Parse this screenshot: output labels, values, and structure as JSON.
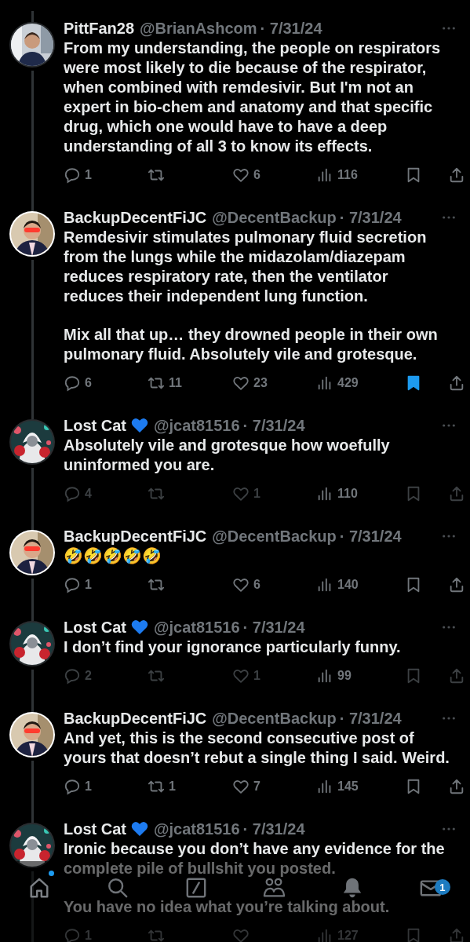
{
  "tweets": [
    {
      "name": "PittFan28",
      "heart_badge": false,
      "handle": "@BrianAshcom",
      "date": "· 7/31/24",
      "body": [
        "From my understanding, the people on respirators were most likely to die because of the respirator, when combined with remdesivir. But I'm not an expert in bio-chem and anatomy and that specific drug, which one would have to have a deep understanding of all 3 to know its effects."
      ],
      "replies": "1",
      "likes": "6",
      "views": "116",
      "bookmarked": false,
      "faded": false
    },
    {
      "name": "BackupDecentFiJC",
      "heart_badge": false,
      "handle": "@DecentBackup",
      "date": "· 7/31/24",
      "body": [
        "Remdesivir stimulates pulmonary fluid secretion from the lungs while the midazolam/diazepam reduces respiratory rate, then the ventilator reduces their independent lung function.",
        "Mix all that up… they drowned people in their own pulmonary fluid. Absolutely vile and grotesque."
      ],
      "replies": "6",
      "reposts": "11",
      "likes": "23",
      "views": "429",
      "bookmarked": true,
      "faded": false
    },
    {
      "name": "Lost Cat",
      "heart_badge": true,
      "handle": "@jcat81516",
      "date": "· 7/31/24",
      "body": [
        "Absolutely vile and grotesque how woefully uninformed you are."
      ],
      "replies": "4",
      "likes": "1",
      "views": "110",
      "bookmarked": false,
      "faded": true
    },
    {
      "name": "BackupDecentFiJC",
      "heart_badge": false,
      "handle": "@DecentBackup",
      "date": "· 7/31/24",
      "body": [
        "🤣🤣🤣🤣🤣"
      ],
      "replies": "1",
      "likes": "6",
      "views": "140",
      "bookmarked": false,
      "faded": false
    },
    {
      "name": "Lost Cat",
      "heart_badge": true,
      "handle": "@jcat81516",
      "date": "· 7/31/24",
      "body": [
        "I don’t find your ignorance particularly funny."
      ],
      "replies": "2",
      "likes": "1",
      "views": "99",
      "bookmarked": false,
      "faded": true
    },
    {
      "name": "BackupDecentFiJC",
      "heart_badge": false,
      "handle": "@DecentBackup",
      "date": "· 7/31/24",
      "body": [
        "And yet, this is the second consecutive post of yours that doesn’t rebut a single thing I said. Weird."
      ],
      "replies": "1",
      "reposts": "1",
      "likes": "7",
      "views": "145",
      "bookmarked": false,
      "faded": false
    },
    {
      "name": "Lost Cat",
      "heart_badge": true,
      "handle": "@jcat81516",
      "date": "· 7/31/24",
      "body": [
        "Ironic because you don’t have any evidence for the complete pile of bullshit you posted.",
        "You have no idea what you’re talking about."
      ],
      "replies": "1",
      "views": "127",
      "bookmarked": false,
      "faded": false
    }
  ],
  "nav": {
    "items": [
      {
        "kind": "home",
        "selected": true,
        "dot": true
      },
      {
        "kind": "search",
        "selected": false
      },
      {
        "kind": "grok",
        "selected": false
      },
      {
        "kind": "communities",
        "selected": false
      },
      {
        "kind": "notifications",
        "selected": false
      },
      {
        "kind": "messages",
        "selected": false,
        "badge": "1"
      }
    ]
  }
}
